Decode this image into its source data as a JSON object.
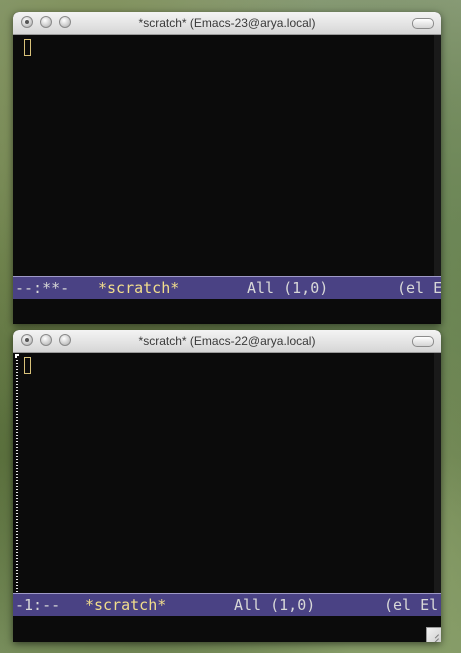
{
  "windows": [
    {
      "title": "*scratch* (Emacs-23@arya.local)",
      "modeline": {
        "status": "--:**-",
        "buffer": "*scratch*",
        "position": "All (1,0)",
        "mode": "(el E"
      }
    },
    {
      "title": "*scratch* (Emacs-22@arya.local)",
      "modeline": {
        "status": "-1:--",
        "buffer": "*scratch*",
        "position": "All (1,0)",
        "mode": "(el El"
      }
    }
  ],
  "colors": {
    "background": "#0b0b0b",
    "modeline": "#4a4284",
    "buffer_name": "#f2de8c",
    "cursor": "#d9c27a"
  },
  "icons": [
    "close-button-icon",
    "minimize-button-icon",
    "zoom-button-icon",
    "toolbar-toggle-icon",
    "resize-grip-icon"
  ]
}
